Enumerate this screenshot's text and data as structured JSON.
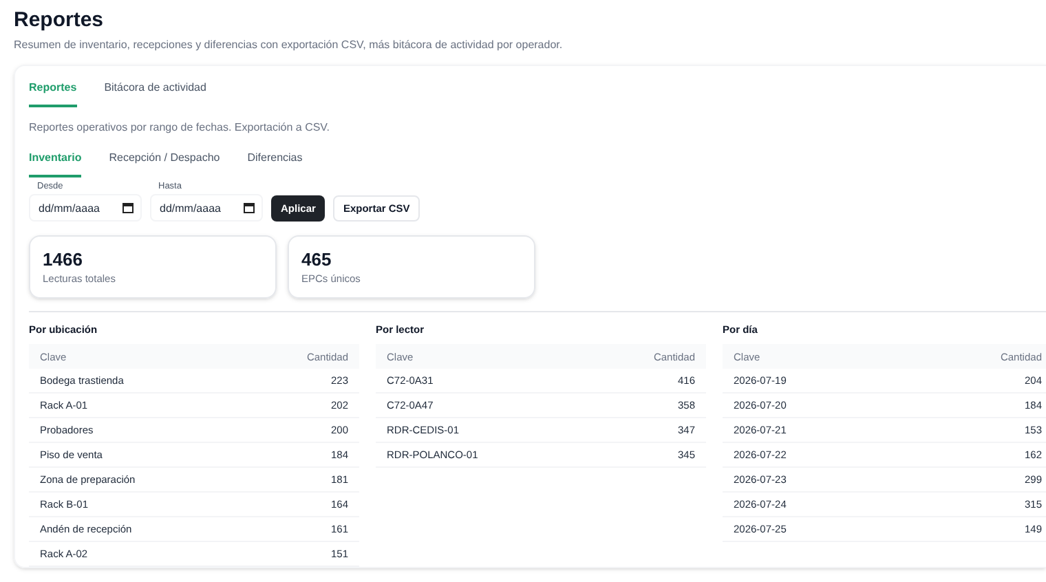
{
  "title": "Reportes",
  "subtitle": "Resumen de inventario, recepciones y diferencias con exportación CSV, más bitácora de actividad por operador.",
  "tabs": [
    {
      "label": "Reportes",
      "selected": true
    },
    {
      "label": "Bitácora de actividad",
      "selected": false
    }
  ],
  "description": "Reportes operativos por rango de fechas. Exportación a CSV.",
  "subtabs": [
    {
      "label": "Inventario",
      "selected": true
    },
    {
      "label": "Recepción / Despacho",
      "selected": false
    },
    {
      "label": "Diferencias",
      "selected": false
    }
  ],
  "filters": [
    {
      "label": "Desde",
      "placeholder": "dd/mm/aaaa"
    },
    {
      "label": "Hasta",
      "placeholder": "dd/mm/aaaa"
    }
  ],
  "buttons": [
    {
      "label": "Aplicar",
      "kind": "primary"
    },
    {
      "label": "Exportar CSV",
      "kind": "secondary"
    }
  ],
  "stats": [
    {
      "value": "1466",
      "label": "Lecturas totales"
    },
    {
      "value": "465",
      "label": "EPCs únicos"
    }
  ],
  "tables": [
    {
      "title": "Por ubicación",
      "columns": [
        "Clave",
        "Cantidad"
      ],
      "rows": [
        [
          "Bodega trastienda",
          "223"
        ],
        [
          "Rack A-01",
          "202"
        ],
        [
          "Probadores",
          "200"
        ],
        [
          "Piso de venta",
          "184"
        ],
        [
          "Zona de preparación",
          "181"
        ],
        [
          "Rack B-01",
          "164"
        ],
        [
          "Andén de recepción",
          "161"
        ],
        [
          "Rack A-02",
          "151"
        ]
      ]
    },
    {
      "title": "Por lector",
      "columns": [
        "Clave",
        "Cantidad"
      ],
      "rows": [
        [
          "C72-0A31",
          "416"
        ],
        [
          "C72-0A47",
          "358"
        ],
        [
          "RDR-CEDIS-01",
          "347"
        ],
        [
          "RDR-POLANCO-01",
          "345"
        ]
      ]
    },
    {
      "title": "Por día",
      "columns": [
        "Clave",
        "Cantidad"
      ],
      "rows": [
        [
          "2026-07-19",
          "204"
        ],
        [
          "2026-07-20",
          "184"
        ],
        [
          "2026-07-21",
          "153"
        ],
        [
          "2026-07-22",
          "162"
        ],
        [
          "2026-07-23",
          "299"
        ],
        [
          "2026-07-24",
          "315"
        ],
        [
          "2026-07-25",
          "149"
        ]
      ]
    }
  ]
}
